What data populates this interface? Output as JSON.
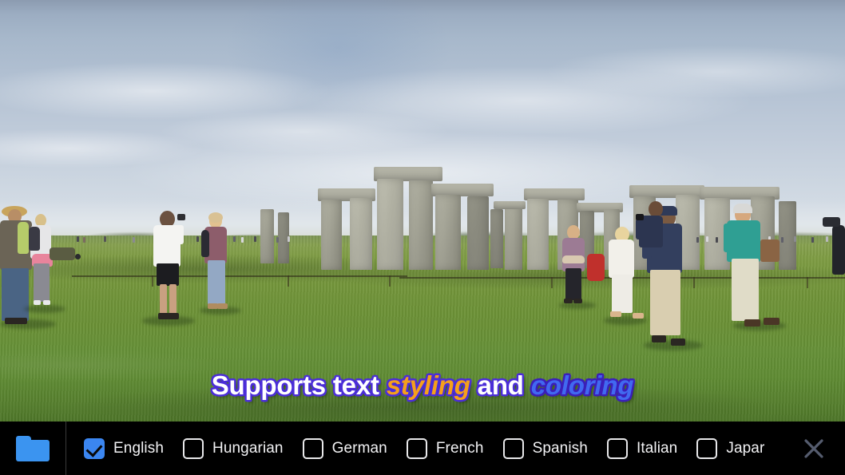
{
  "player": {
    "subtitle": {
      "segments": [
        {
          "text": "Supports text ",
          "style": "plain"
        },
        {
          "text": "styling",
          "style": "accent-orange"
        },
        {
          "text": " and ",
          "style": "plain"
        },
        {
          "text": "coloring",
          "style": "accent-blue"
        }
      ],
      "full_text": "Supports text styling and coloring"
    },
    "scene_description": "Stonehenge with tourists on green grass under a pale blue sky"
  },
  "toolbar": {
    "folder_icon": "folder-icon",
    "close_icon": "close-icon",
    "languages": [
      {
        "label": "English",
        "checked": true
      },
      {
        "label": "Hungarian",
        "checked": false
      },
      {
        "label": "German",
        "checked": false
      },
      {
        "label": "French",
        "checked": false
      },
      {
        "label": "Spanish",
        "checked": false
      },
      {
        "label": "Italian",
        "checked": false
      },
      {
        "label": "Japar",
        "checked": false
      }
    ]
  },
  "colors": {
    "toolbar_bg": "#000000",
    "folder_blue": "#3b94f0",
    "checkbox_blue": "#3b86f0",
    "checkbox_outline": "#e8e8ea",
    "label_text": "#f2f2f4",
    "close_icon": "#555c6e",
    "subtitle_white": "#ffffff",
    "subtitle_orange": "#f5a01b",
    "subtitle_blue": "#4169f0",
    "subtitle_outline": "#4b2dd8"
  }
}
